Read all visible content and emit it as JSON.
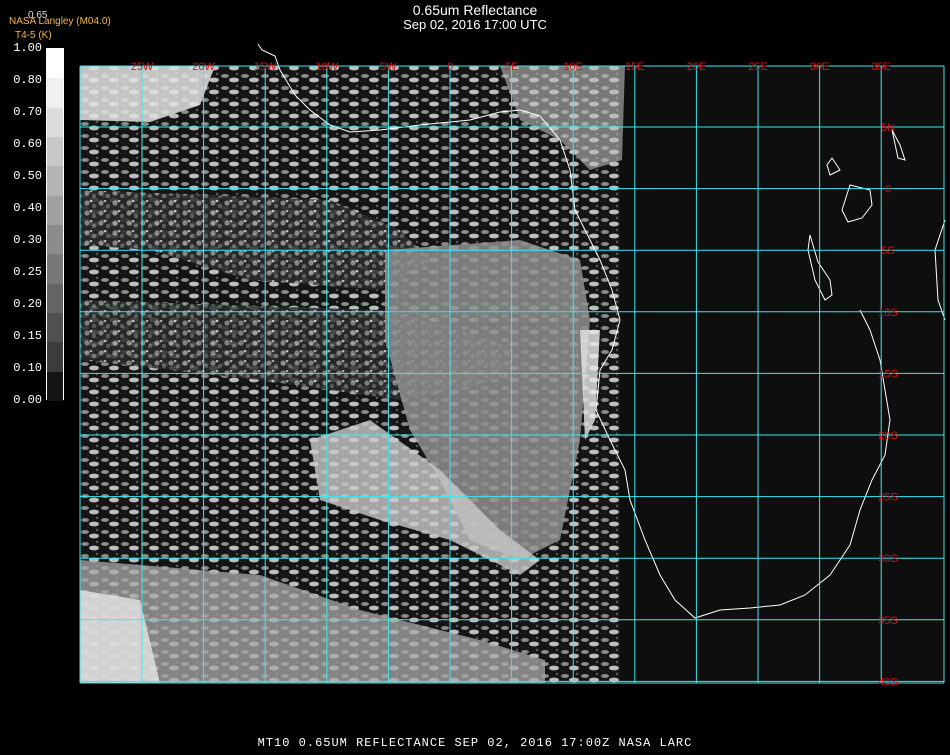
{
  "header": {
    "title": "0.65um Reflectance",
    "datetime": "Sep 02, 2016 17:00 UTC",
    "credit": "NASA Langley (M04.0)",
    "sublabel": "T4-5 (K)",
    "band_label": "0.65"
  },
  "legend": {
    "labels": [
      "1.00",
      "0.80",
      "0.70",
      "0.60",
      "0.50",
      "0.40",
      "0.30",
      "0.25",
      "0.20",
      "0.15",
      "0.10",
      "0.00"
    ],
    "colors": [
      "#ffffff",
      "#f0f0f0",
      "#dcdcdc",
      "#c8c8c8",
      "#b4b4b4",
      "#a0a0a0",
      "#8c8c8c",
      "#787878",
      "#646464",
      "#505050",
      "#3c3c3c",
      "#141414"
    ]
  },
  "grid": {
    "color": "#3ee6f0",
    "lon_labels": [
      "25W",
      "20W",
      "15W",
      "10W",
      "5W",
      "0",
      "5E",
      "10E",
      "15E",
      "20E",
      "25E",
      "30E",
      "35E"
    ],
    "lat_labels": [
      "5N",
      "0",
      "5S",
      "10S",
      "15S",
      "20S",
      "25S",
      "30S",
      "35S",
      "40S"
    ],
    "label_color": "#e01010"
  },
  "footer": {
    "caption": "MT10  0.65UM REFLECTANCE   SEP 02, 2016 17:00Z   NASA LARC"
  }
}
